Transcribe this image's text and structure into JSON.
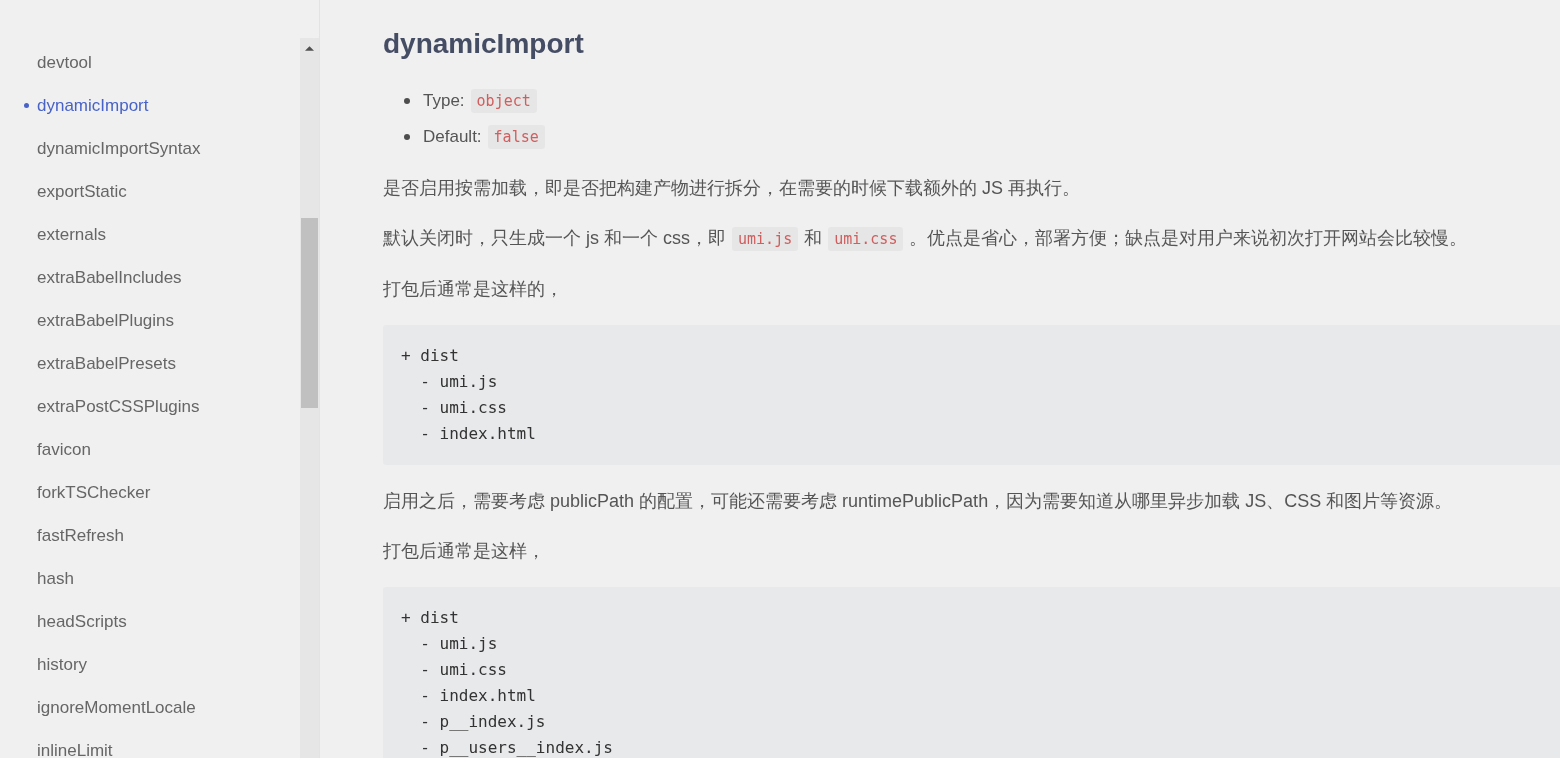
{
  "sidebar": {
    "items": [
      {
        "label": "devtool",
        "selected": false
      },
      {
        "label": "dynamicImport",
        "selected": true
      },
      {
        "label": "dynamicImportSyntax",
        "selected": false
      },
      {
        "label": "exportStatic",
        "selected": false
      },
      {
        "label": "externals",
        "selected": false
      },
      {
        "label": "extraBabelIncludes",
        "selected": false
      },
      {
        "label": "extraBabelPlugins",
        "selected": false
      },
      {
        "label": "extraBabelPresets",
        "selected": false
      },
      {
        "label": "extraPostCSSPlugins",
        "selected": false
      },
      {
        "label": "favicon",
        "selected": false
      },
      {
        "label": "forkTSChecker",
        "selected": false
      },
      {
        "label": "fastRefresh",
        "selected": false
      },
      {
        "label": "hash",
        "selected": false
      },
      {
        "label": "headScripts",
        "selected": false
      },
      {
        "label": "history",
        "selected": false
      },
      {
        "label": "ignoreMomentLocale",
        "selected": false
      },
      {
        "label": "inlineLimit",
        "selected": false
      }
    ]
  },
  "article": {
    "title": "dynamicImport",
    "properties": [
      {
        "label": "Type:",
        "value": "object"
      },
      {
        "label": "Default:",
        "value": "false"
      }
    ],
    "blocks": [
      {
        "kind": "paragraph",
        "parts": [
          {
            "kind": "text",
            "text": "是否启用按需加载，即是否把构建产物进行拆分，在需要的时候下载额外的 JS 再执行。"
          }
        ]
      },
      {
        "kind": "paragraph",
        "parts": [
          {
            "kind": "text",
            "text": "默认关闭时，只生成一个 js 和一个 css，即"
          },
          {
            "kind": "code",
            "text": "umi.js"
          },
          {
            "kind": "text",
            "text": "和"
          },
          {
            "kind": "code",
            "text": "umi.css"
          },
          {
            "kind": "text",
            "text": "。优点是省心，部署方便；缺点是对用户来说初次打开网站会比较慢。"
          }
        ]
      },
      {
        "kind": "paragraph",
        "parts": [
          {
            "kind": "text",
            "text": "打包后通常是这样的，"
          }
        ]
      },
      {
        "kind": "code",
        "lines": [
          "+ dist",
          "  - umi.js",
          "  - umi.css",
          "  - index.html"
        ]
      },
      {
        "kind": "paragraph",
        "parts": [
          {
            "kind": "text",
            "text": "启用之后，需要考虑 publicPath 的配置，可能还需要考虑 runtimePublicPath，因为需要知道从哪里异步加载 JS、CSS 和图片等资源。"
          }
        ]
      },
      {
        "kind": "paragraph",
        "parts": [
          {
            "kind": "text",
            "text": "打包后通常是这样，"
          }
        ]
      },
      {
        "kind": "code",
        "lines": [
          "+ dist",
          "  - umi.js",
          "  - umi.css",
          "  - index.html",
          "  - p__index.js",
          "  - p__users__index.js"
        ]
      }
    ]
  }
}
